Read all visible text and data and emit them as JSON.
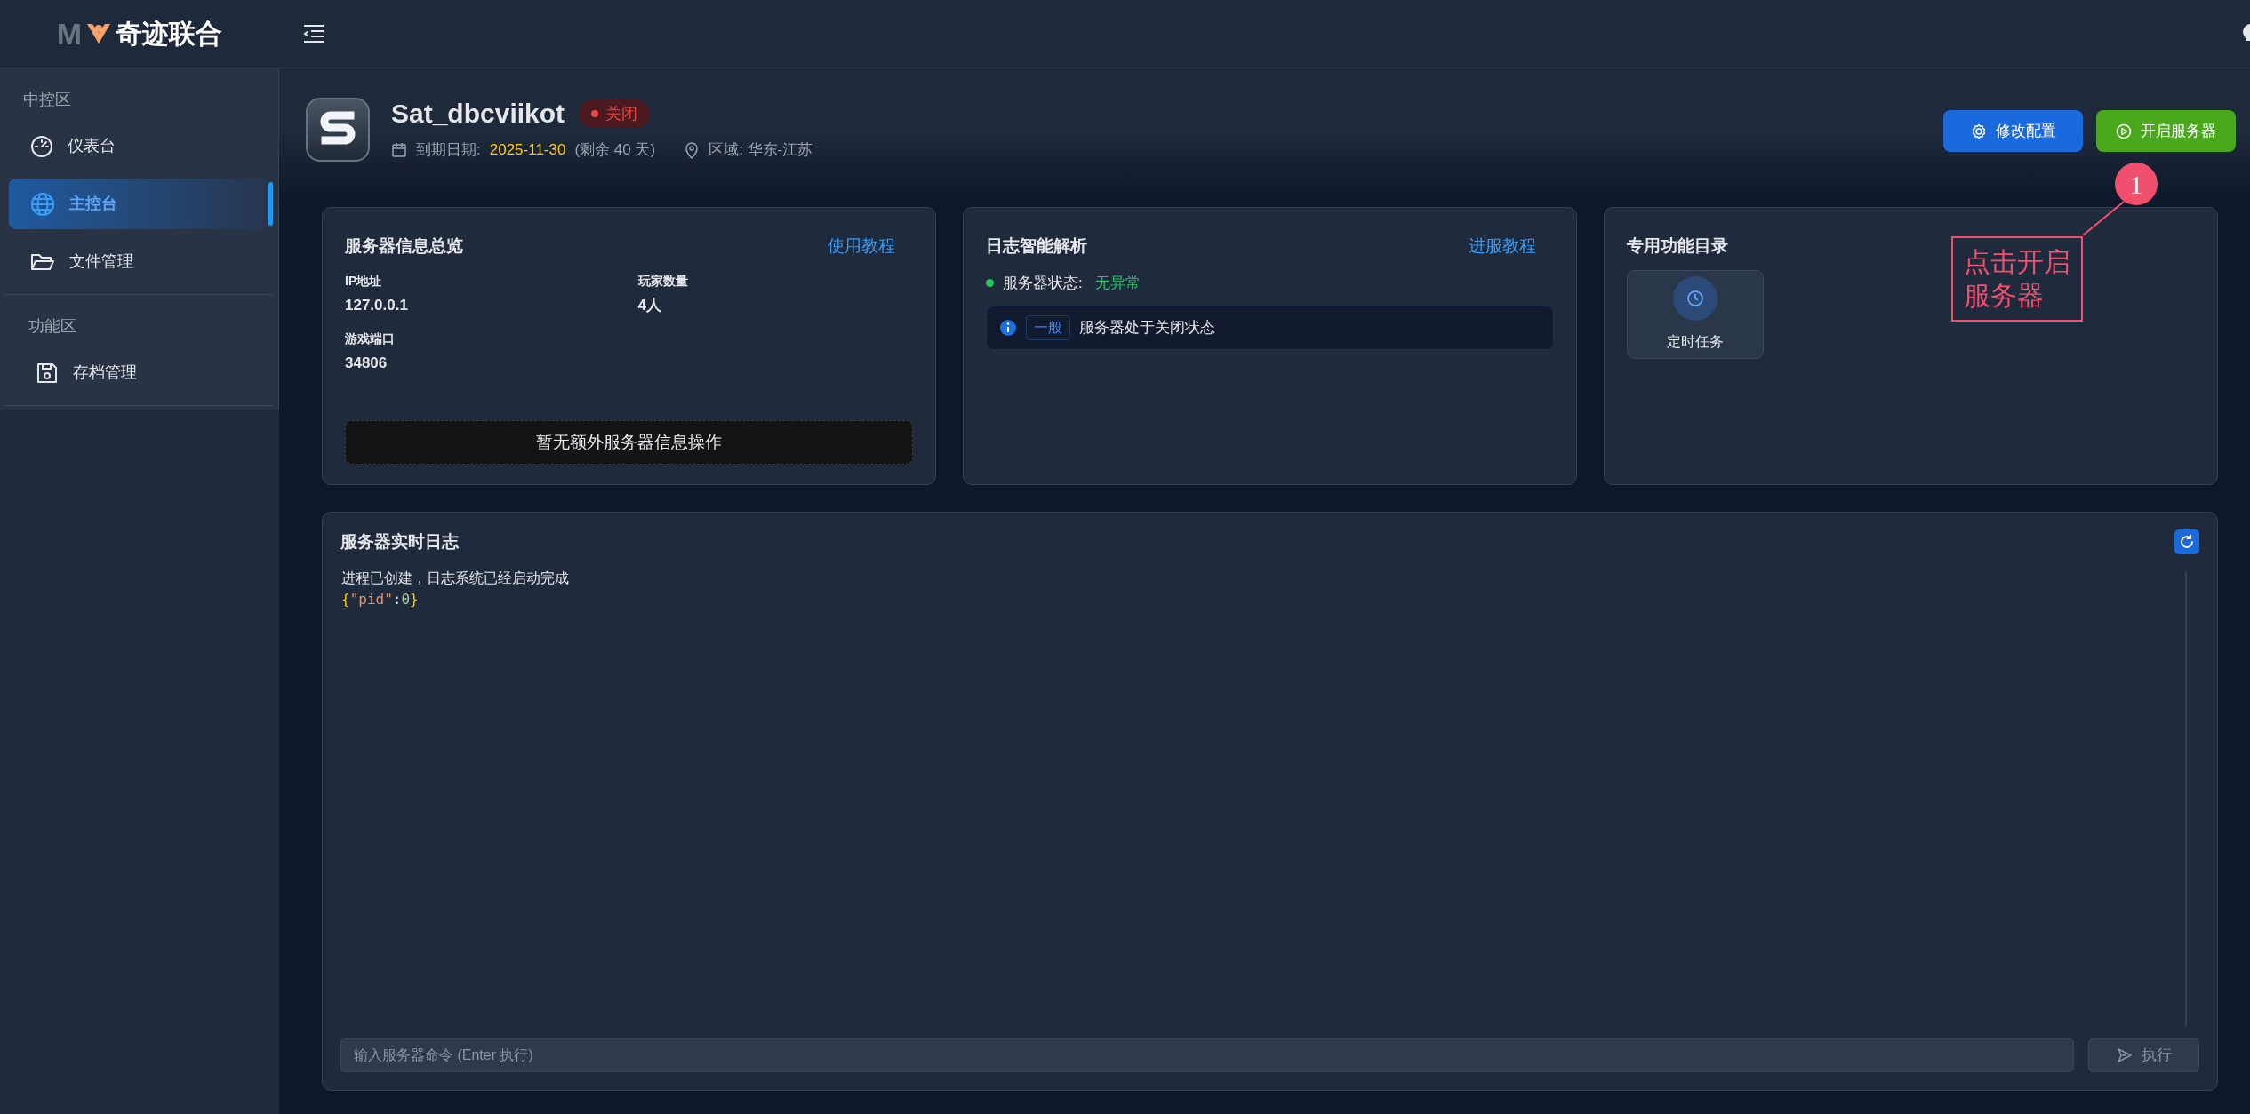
{
  "header": {
    "logo_letter": "M",
    "logo_text": "奇迹联合"
  },
  "sidebar": {
    "sections": [
      {
        "label": "中控区",
        "items": [
          {
            "label": "仪表台",
            "kind": "gauge",
            "selected": false
          },
          {
            "label": "主控台",
            "kind": "globe",
            "selected": true
          },
          {
            "label": "文件管理",
            "kind": "folder",
            "selected": false
          }
        ]
      },
      {
        "label": "功能区",
        "items": [
          {
            "label": "存档管理",
            "kind": "save",
            "selected": false
          }
        ]
      }
    ]
  },
  "server": {
    "name": "Sat_dbcviikot",
    "status": {
      "label": "关闭",
      "running": false
    },
    "expiry_label": "到期日期:",
    "expiry_date": "2025-11-30",
    "remaining": "(剩余 40 天)",
    "region": "区域: 华东-江苏",
    "buttons": [
      {
        "label": "修改配置",
        "kind": "config"
      },
      {
        "label": "开启服务器",
        "kind": "start"
      }
    ]
  },
  "info_card": {
    "title": "服务器信息总览",
    "link": "使用教程",
    "fields": [
      {
        "label": "IP地址",
        "value": "127.0.0.1"
      },
      {
        "label": "玩家数量",
        "value": "4人"
      },
      {
        "label": "游戏端口",
        "value": "34806"
      }
    ],
    "notice": "暂无额外服务器信息操作"
  },
  "analysis_card": {
    "title": "日志智能解析",
    "link": "进服教程",
    "health": {
      "label": "服务器状态:",
      "value": "无异常",
      "healthy": true
    },
    "entries": [
      {
        "level": "一般",
        "message": "服务器处于关闭状态"
      }
    ]
  },
  "functions_card": {
    "title": "专用功能目录",
    "items": [
      {
        "label": "定时任务"
      }
    ]
  },
  "log": {
    "title": "服务器实时日志",
    "lines": [
      [
        {
          "kind": "plain",
          "text": "进程已创建，日志系统已经启动完成"
        }
      ],
      [
        {
          "kind": "brace",
          "text": "{"
        },
        {
          "kind": "string",
          "text": "\"pid\""
        },
        {
          "kind": "plain",
          "text": ":"
        },
        {
          "kind": "number",
          "text": "0"
        },
        {
          "kind": "brace",
          "text": "}"
        }
      ]
    ],
    "input": {
      "placeholder": "输入服务器命令 (Enter 执行)"
    },
    "send": "执行"
  },
  "annotation": {
    "number": "1",
    "text": "点击开启服务器"
  }
}
